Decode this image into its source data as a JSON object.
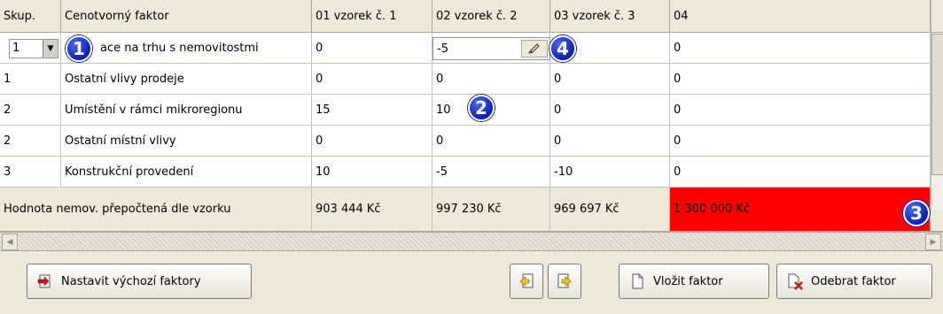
{
  "table": {
    "headers": [
      "Skup.",
      "Cenotvorný faktor",
      "01 vzorek č. 1",
      "02 vzorek č. 2",
      "03 vzorek č. 3",
      "04"
    ],
    "rows": [
      {
        "group": "1",
        "factor": "ace na trhu s nemovitostmi",
        "v1": "0",
        "v2": "-5",
        "v3": "",
        "v4": "0"
      },
      {
        "group": "1",
        "factor": "Ostatní vlivy prodeje",
        "v1": "0",
        "v2": "0",
        "v3": "0",
        "v4": "0"
      },
      {
        "group": "2",
        "factor": "Umístění v rámci mikroregionu",
        "v1": "15",
        "v2": "10",
        "v3": "0",
        "v4": "0"
      },
      {
        "group": "2",
        "factor": "Ostatní místní vlivy",
        "v1": "0",
        "v2": "0",
        "v3": "0",
        "v4": "0"
      },
      {
        "group": "3",
        "factor": "Konstrukční provedení",
        "v1": "10",
        "v2": "-5",
        "v3": "-10",
        "v4": "0"
      }
    ],
    "total": {
      "label": "Hodnota nemov. přepočtená dle vzorku",
      "v1": "903 444 Kč",
      "v2": "997 230 Kč",
      "v3": "969 697 Kč",
      "v4": "1 300 000 Kč"
    }
  },
  "badges": [
    "1",
    "2",
    "3",
    "4"
  ],
  "buttons": {
    "default_factors": "Nastavit výchozí faktory",
    "insert_factor": "Vložit faktor",
    "remove_factor": "Odebrat faktor"
  },
  "colors": {
    "highlight": "#ff0000",
    "badge": "#0a1fb8"
  }
}
